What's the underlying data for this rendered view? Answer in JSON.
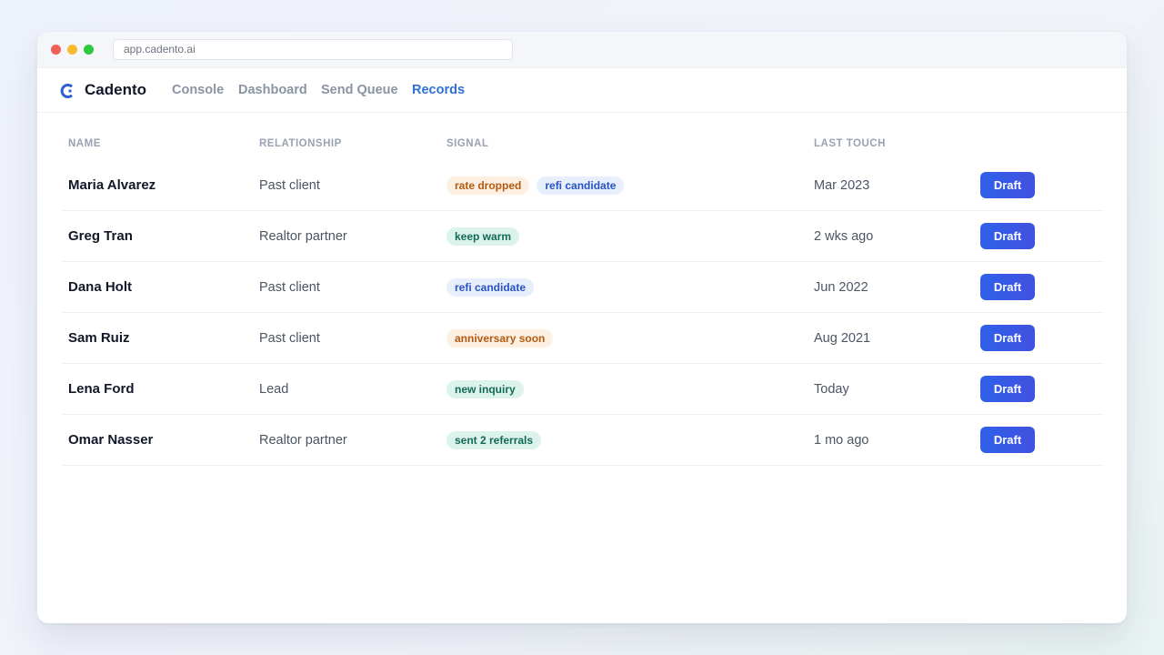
{
  "browser": {
    "url": "app.cadento.ai"
  },
  "brand": {
    "name": "Cadento",
    "logo_icon": "cadento-logo-icon",
    "accent": "#2f6fd6"
  },
  "nav": {
    "items": [
      {
        "label": "Console",
        "active": false
      },
      {
        "label": "Dashboard",
        "active": false
      },
      {
        "label": "Send Queue",
        "active": false
      },
      {
        "label": "Records",
        "active": true
      }
    ]
  },
  "table": {
    "headers": {
      "name": "NAME",
      "relationship": "RELATIONSHIP",
      "signal": "SIGNAL",
      "last_touch": "LAST TOUCH"
    },
    "rows": [
      {
        "name": "Maria Alvarez",
        "relationship": "Past client",
        "signals": [
          {
            "label": "rate dropped",
            "color": "orange"
          },
          {
            "label": "refi candidate",
            "color": "blue"
          }
        ],
        "last_touch": "Mar 2023",
        "action": "Draft"
      },
      {
        "name": "Greg Tran",
        "relationship": "Realtor partner",
        "signals": [
          {
            "label": "keep warm",
            "color": "green"
          }
        ],
        "last_touch": "2 wks ago",
        "action": "Draft"
      },
      {
        "name": "Dana Holt",
        "relationship": "Past client",
        "signals": [
          {
            "label": "refi candidate",
            "color": "blue"
          }
        ],
        "last_touch": "Jun 2022",
        "action": "Draft"
      },
      {
        "name": "Sam Ruiz",
        "relationship": "Past client",
        "signals": [
          {
            "label": "anniversary soon",
            "color": "orange"
          }
        ],
        "last_touch": "Aug 2021",
        "action": "Draft"
      },
      {
        "name": "Lena Ford",
        "relationship": "Lead",
        "signals": [
          {
            "label": "new inquiry",
            "color": "green"
          }
        ],
        "last_touch": "Today",
        "action": "Draft"
      },
      {
        "name": "Omar Nasser",
        "relationship": "Realtor partner",
        "signals": [
          {
            "label": "sent 2 referrals",
            "color": "green"
          }
        ],
        "last_touch": "1 mo ago",
        "action": "Draft"
      }
    ]
  }
}
